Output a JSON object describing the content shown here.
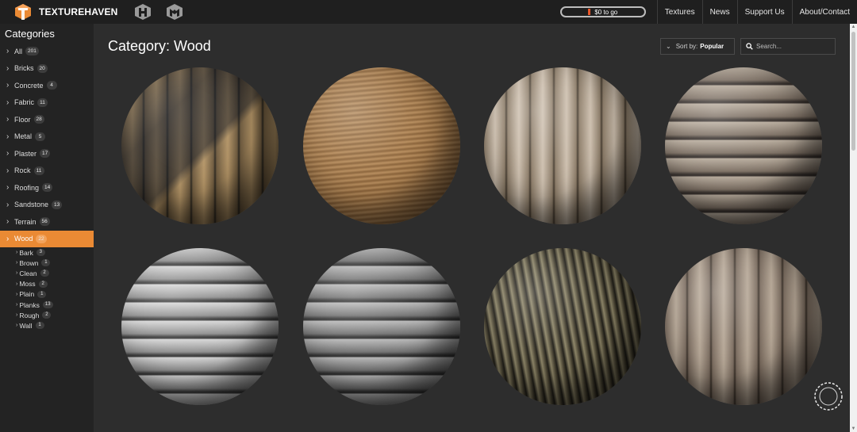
{
  "header": {
    "brand": "TEXTUREHAVEN",
    "donate_label": "$0 to go",
    "nav": [
      "Textures",
      "News",
      "Support Us",
      "About/Contact"
    ]
  },
  "sidebar": {
    "title": "Categories",
    "categories": [
      {
        "label": "All",
        "count": "201"
      },
      {
        "label": "Bricks",
        "count": "20"
      },
      {
        "label": "Concrete",
        "count": "4"
      },
      {
        "label": "Fabric",
        "count": "11"
      },
      {
        "label": "Floor",
        "count": "28"
      },
      {
        "label": "Metal",
        "count": "5"
      },
      {
        "label": "Plaster",
        "count": "17"
      },
      {
        "label": "Rock",
        "count": "11"
      },
      {
        "label": "Roofing",
        "count": "14"
      },
      {
        "label": "Sandstone",
        "count": "13"
      },
      {
        "label": "Terrain",
        "count": "56"
      },
      {
        "label": "Wood",
        "count": "22",
        "active": true
      }
    ],
    "subcategories": [
      {
        "label": "Bark",
        "count": "3"
      },
      {
        "label": "Brown",
        "count": "1"
      },
      {
        "label": "Clean",
        "count": "2"
      },
      {
        "label": "Moss",
        "count": "2"
      },
      {
        "label": "Plain",
        "count": "1"
      },
      {
        "label": "Planks",
        "count": "13"
      },
      {
        "label": "Rough",
        "count": "2"
      },
      {
        "label": "Wall",
        "count": "1"
      }
    ]
  },
  "main": {
    "title": "Category: Wood",
    "sort_prefix": "Sort by:",
    "sort_value": "Popular",
    "search_placeholder": "Search..."
  },
  "textures": [
    {
      "name": "wood-sphere-1",
      "base": "#6e5a3e",
      "light": "#b39466",
      "dark": "#2c2820",
      "style": "vertical-dark"
    },
    {
      "name": "wood-sphere-2",
      "base": "#8a6238",
      "light": "#b88d5c",
      "dark": "#3f2c18",
      "style": "smooth"
    },
    {
      "name": "wood-sphere-3",
      "base": "#8d7d69",
      "light": "#cdbfae",
      "dark": "#463c30",
      "style": "vertical"
    },
    {
      "name": "wood-sphere-4",
      "base": "#7d7064",
      "light": "#b7ab9c",
      "dark": "#3b3430",
      "style": "planks-h"
    },
    {
      "name": "wood-sphere-5",
      "base": "#8f8f8f",
      "light": "#d6d6d6",
      "dark": "#3f3f3f",
      "style": "planks-h"
    },
    {
      "name": "wood-sphere-6",
      "base": "#727272",
      "light": "#b8b8b8",
      "dark": "#353535",
      "style": "planks-h"
    },
    {
      "name": "wood-sphere-7",
      "base": "#4d4735",
      "light": "#8c8466",
      "dark": "#1e1c16",
      "style": "bark"
    },
    {
      "name": "wood-sphere-8",
      "base": "#7a6b5e",
      "light": "#b5a695",
      "dark": "#3a3129",
      "style": "vertical"
    }
  ]
}
